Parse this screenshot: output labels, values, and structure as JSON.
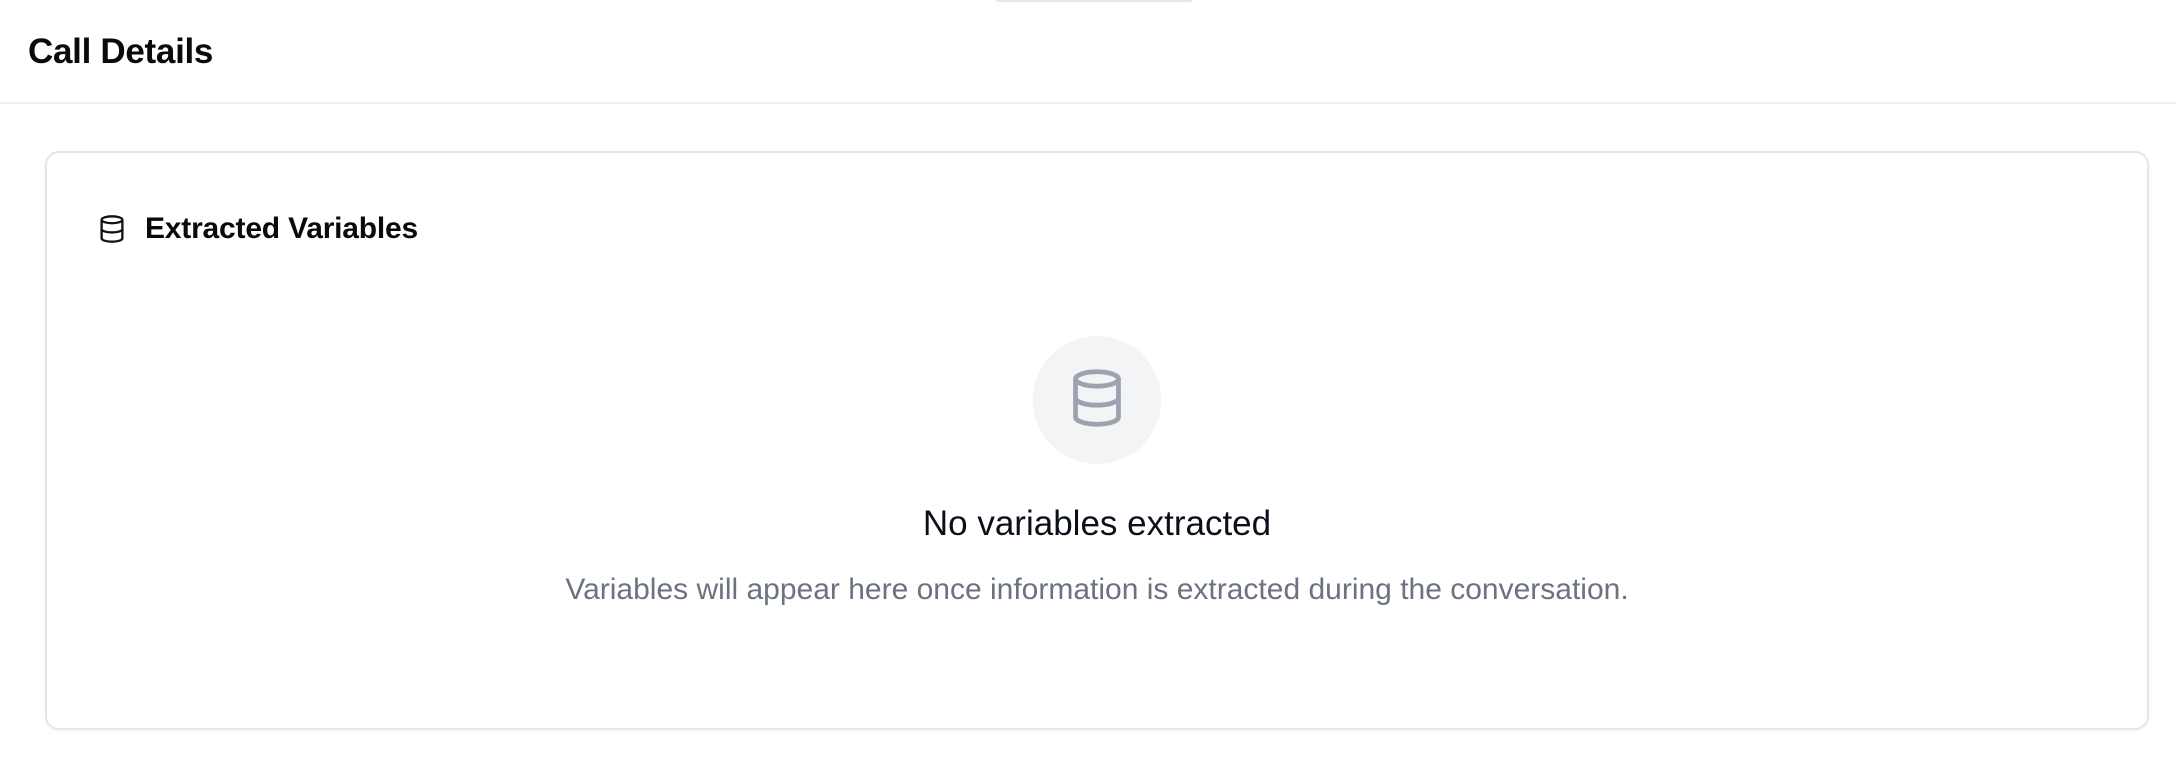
{
  "header": {
    "title": "Call Details"
  },
  "card": {
    "title": "Extracted Variables",
    "icon": "database-icon"
  },
  "empty_state": {
    "icon": "database-icon",
    "title": "No variables extracted",
    "description": "Variables will appear here once information is extracted during the conversation."
  },
  "colors": {
    "border": "#e4e6ea",
    "icon_circle_bg": "#f3f4f6",
    "icon_muted": "#9ca3af",
    "text_muted": "#6b7280",
    "text_primary": "#0b0f19"
  }
}
